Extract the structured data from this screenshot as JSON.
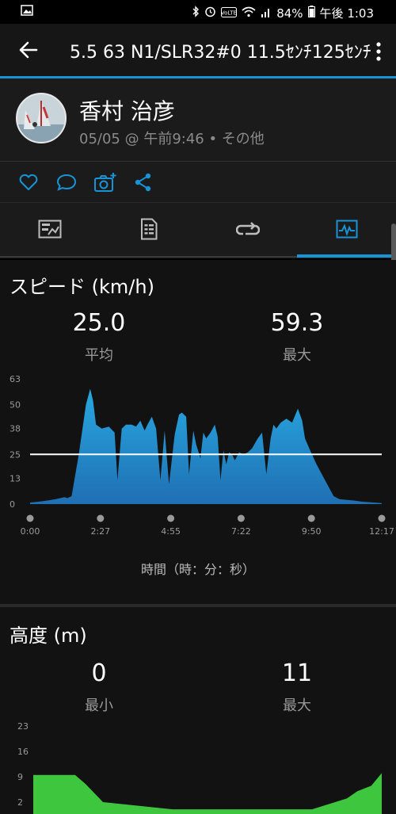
{
  "status": {
    "battery": "84%",
    "time": "午後 1:03"
  },
  "appbar": {
    "title": "5.5 63 N1/SLR32#0 11.5ｾﾝﾁ125ｾﾝﾁ"
  },
  "profile": {
    "name": "香村 治彦",
    "subtitle": "05/05 @ 午前9:46 • その他"
  },
  "actions": {
    "icons": [
      "heart-icon",
      "comment-icon",
      "camera-add-icon",
      "share-icon"
    ]
  },
  "tabs": [
    "overview-tab",
    "details-tab",
    "laps-tab",
    "charts-tab"
  ],
  "speed": {
    "title": "スピード (km/h)",
    "avg_value": "25.0",
    "avg_label": "平均",
    "max_value": "59.3",
    "max_label": "最大",
    "xlabel": "時間（時：分：秒）",
    "colors": {
      "fill_top": "#28a8e0",
      "fill_bottom": "#1f6fb3",
      "avg_line": "#ffffff"
    }
  },
  "elevation": {
    "title": "高度 (m)",
    "min_value": "0",
    "min_label": "最小",
    "max_value": "11",
    "max_label": "最大",
    "colors": {
      "fill": "#3ec63e"
    }
  },
  "chart_data": [
    {
      "type": "area",
      "ylim": [
        0,
        63
      ],
      "yticks": [
        "63",
        "50",
        "38",
        "25",
        "13",
        "0"
      ],
      "xticks": [
        "0:00",
        "2:27",
        "4:55",
        "7:22",
        "9:50",
        "12:17"
      ],
      "avg_line": 25,
      "x": [
        0,
        0.3,
        0.6,
        0.9,
        1.2,
        1.3,
        1.45,
        1.7,
        1.95,
        2.1,
        2.2,
        2.3,
        2.5,
        2.75,
        2.95,
        3.05,
        3.2,
        3.35,
        3.55,
        3.7,
        3.85,
        4.0,
        4.1,
        4.25,
        4.4,
        4.55,
        4.7,
        4.85,
        5.05,
        5.2,
        5.3,
        5.45,
        5.55,
        5.7,
        5.8,
        5.95,
        6.05,
        6.15,
        6.3,
        6.45,
        6.55,
        6.65,
        6.75,
        6.85,
        6.95,
        7.05,
        7.15,
        7.3,
        7.45,
        7.6,
        7.75,
        7.95,
        8.1,
        8.25,
        8.4,
        8.5,
        8.6,
        8.75,
        8.95,
        9.15,
        9.35,
        9.5,
        9.6,
        9.75,
        10.0,
        10.3,
        10.6,
        10.8,
        11.0,
        11.3,
        11.6,
        12.0,
        12.28
      ],
      "y": [
        0.8,
        1.2,
        1.8,
        2.5,
        3.5,
        3.0,
        4.0,
        25,
        50,
        58,
        52,
        40,
        38,
        39,
        36,
        12,
        38,
        40,
        40,
        39,
        42,
        37,
        40,
        44,
        38,
        12,
        37,
        10,
        35,
        45,
        46,
        44,
        15,
        37,
        30,
        23,
        36,
        33,
        36,
        40,
        34,
        12,
        27,
        20,
        26,
        25,
        22,
        26,
        25,
        26,
        28,
        33,
        36,
        15,
        33,
        40,
        38,
        41,
        43,
        41,
        48,
        42,
        33,
        28,
        20,
        12,
        4,
        2.5,
        2.2,
        1.8,
        1.2,
        0.8,
        0.5
      ]
    },
    {
      "type": "area",
      "ylim": [
        0,
        23
      ],
      "yticks": [
        "23",
        "16",
        "9",
        "2"
      ],
      "x": [
        0,
        0.05,
        0.12,
        0.15,
        0.2,
        0.4,
        0.6,
        0.8,
        0.9,
        0.93,
        0.97,
        1.0
      ],
      "y": [
        9.5,
        9.5,
        9.5,
        7,
        2,
        0,
        0,
        0,
        3,
        5,
        6.5,
        10
      ]
    }
  ]
}
